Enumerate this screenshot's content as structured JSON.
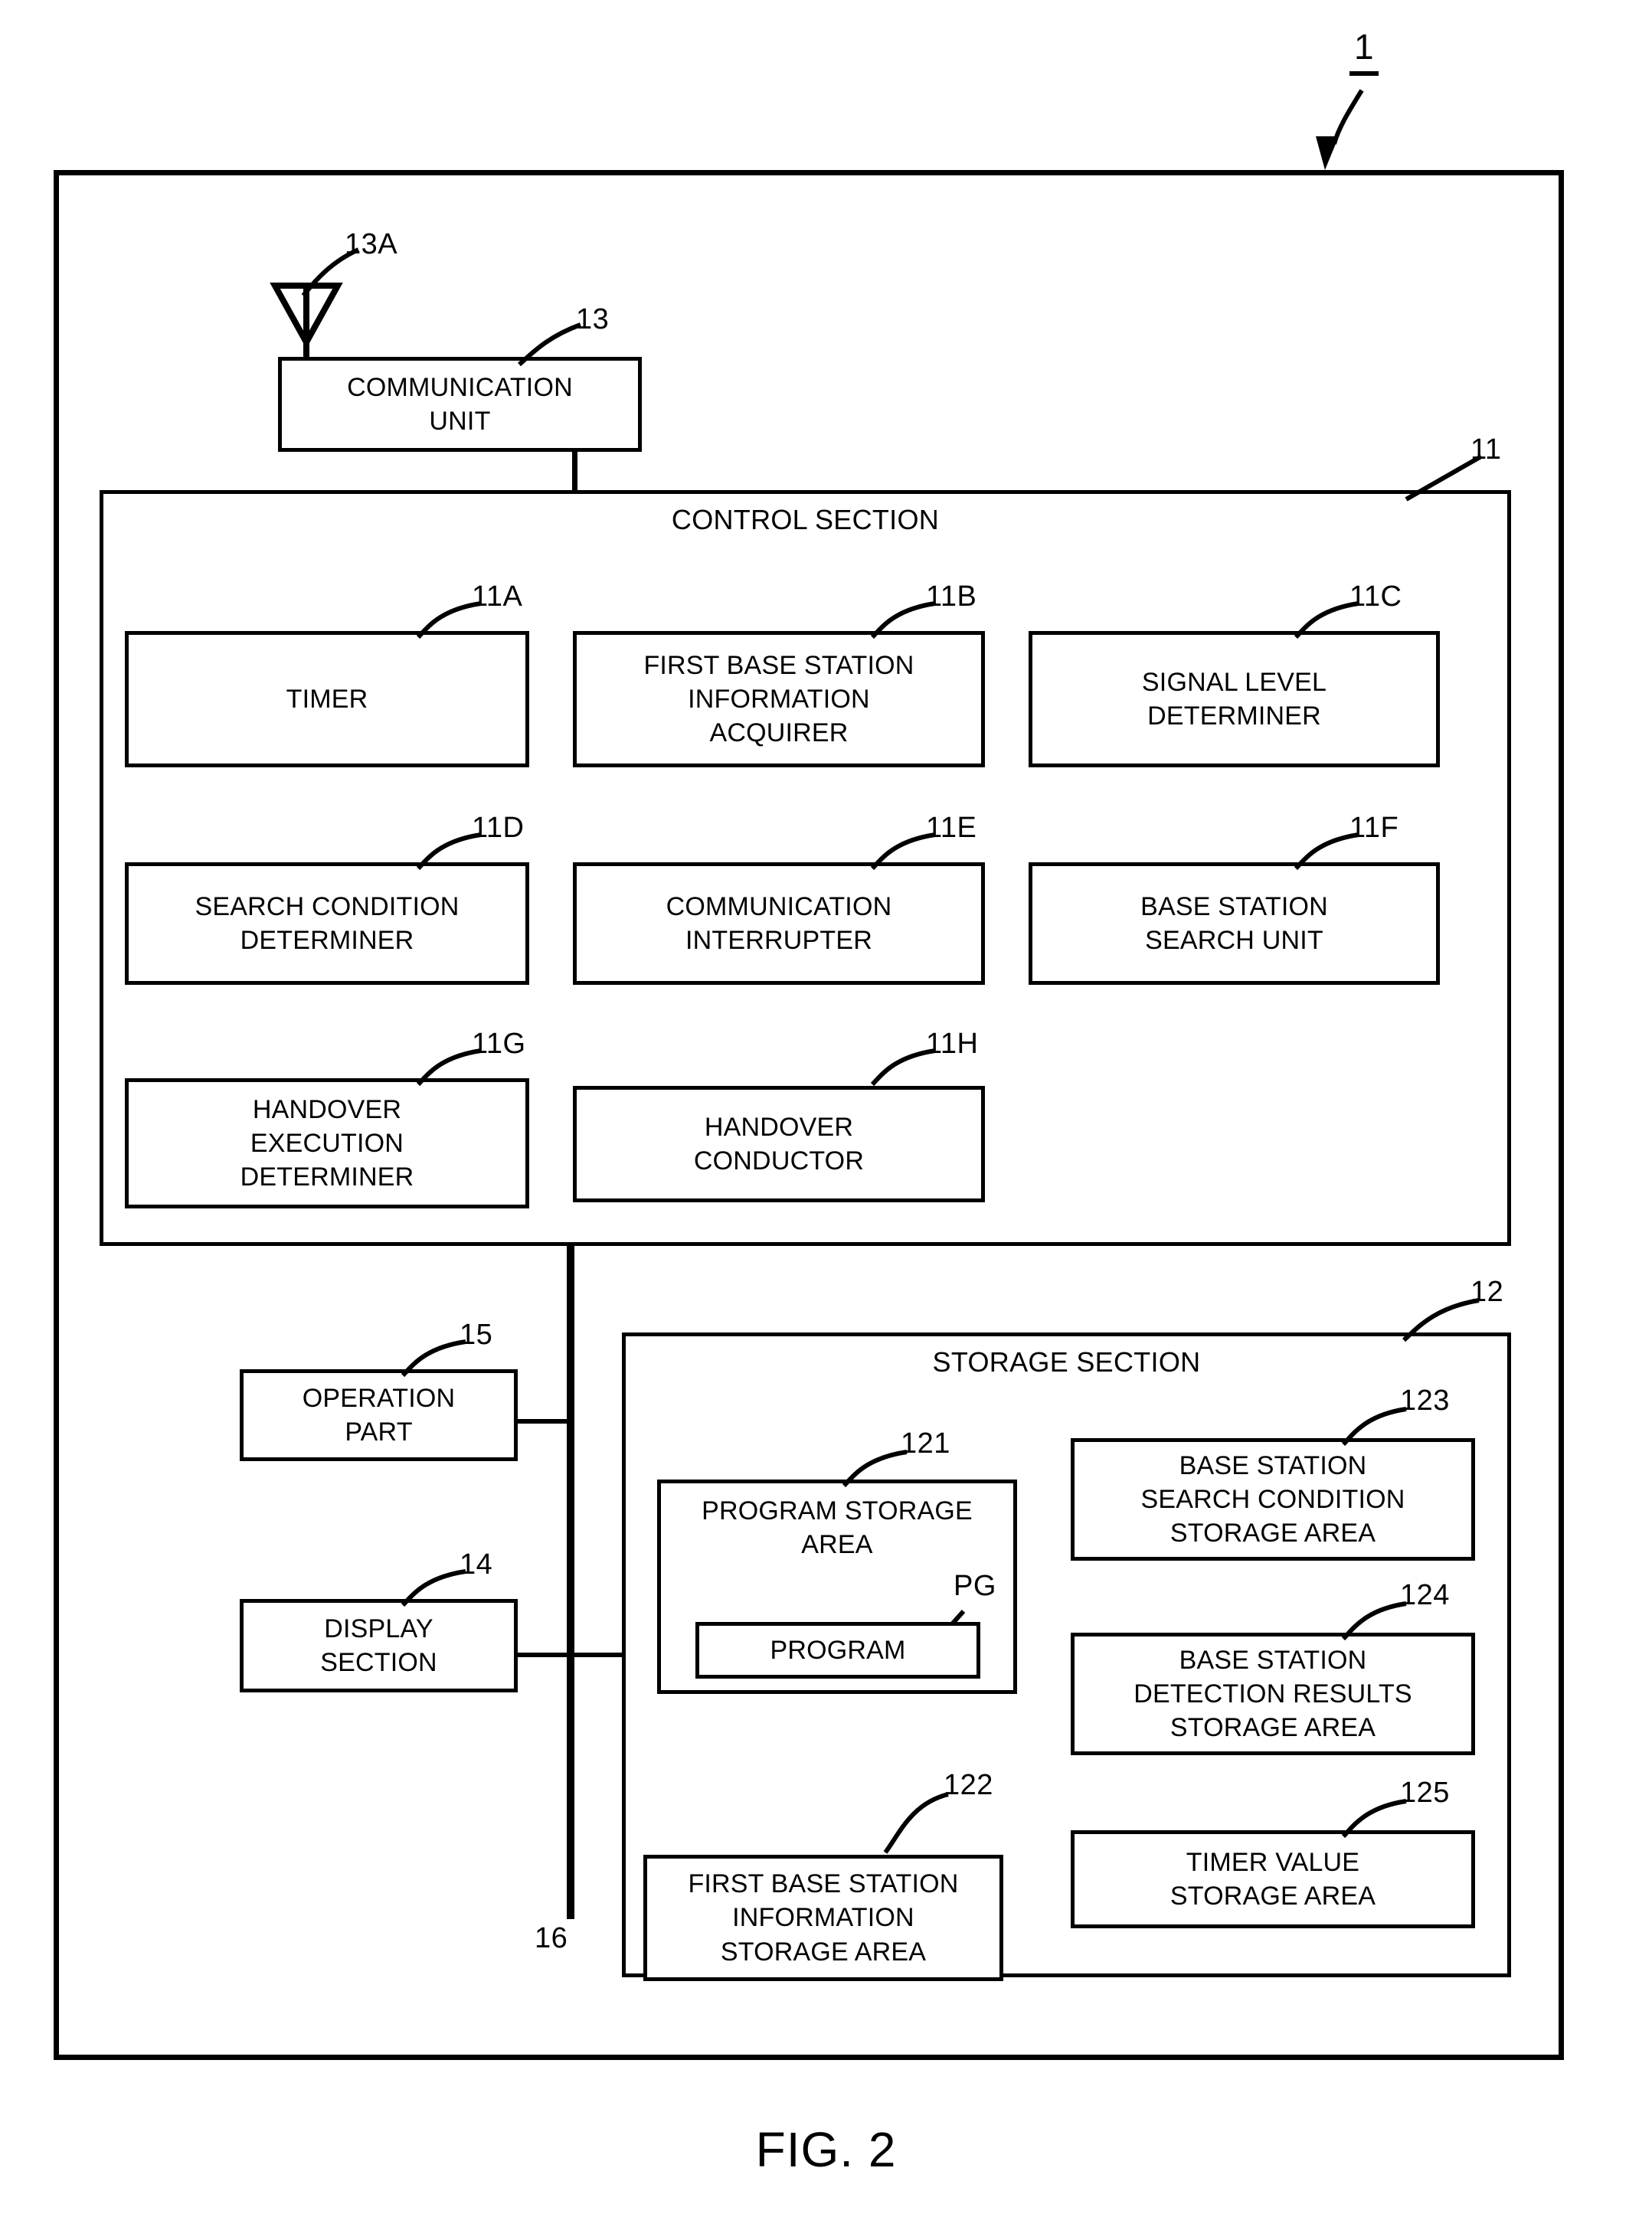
{
  "figure": {
    "caption": "FIG. 2",
    "device_ref": "1"
  },
  "antenna": {
    "ref": "13A",
    "icon": "antenna-icon"
  },
  "communication_unit": {
    "ref": "13",
    "label": "COMMUNICATION\nUNIT"
  },
  "control_section": {
    "ref": "11",
    "title": "CONTROL SECTION",
    "blocks": [
      {
        "ref": "11A",
        "label": "TIMER"
      },
      {
        "ref": "11B",
        "label": "FIRST BASE STATION\nINFORMATION\nACQUIRER"
      },
      {
        "ref": "11C",
        "label": "SIGNAL LEVEL\nDETERMINER"
      },
      {
        "ref": "11D",
        "label": "SEARCH CONDITION\nDETERMINER"
      },
      {
        "ref": "11E",
        "label": "COMMUNICATION\nINTERRUPTER"
      },
      {
        "ref": "11F",
        "label": "BASE STATION\nSEARCH UNIT"
      },
      {
        "ref": "11G",
        "label": "HANDOVER\nEXECUTION\nDETERMINER"
      },
      {
        "ref": "11H",
        "label": "HANDOVER\nCONDUCTOR"
      }
    ]
  },
  "operation_part": {
    "ref": "15",
    "label": "OPERATION\nPART"
  },
  "display_section": {
    "ref": "14",
    "label": "DISPLAY\nSECTION"
  },
  "bus": {
    "ref": "16"
  },
  "storage_section": {
    "ref": "12",
    "title": "STORAGE SECTION",
    "program_storage_area": {
      "ref": "121",
      "label": "PROGRAM STORAGE\nAREA",
      "program": {
        "ref": "PG",
        "label": "PROGRAM"
      }
    },
    "blocks": [
      {
        "ref": "123",
        "label": "BASE STATION\nSEARCH CONDITION\nSTORAGE AREA"
      },
      {
        "ref": "124",
        "label": "BASE STATION\nDETECTION RESULTS\nSTORAGE AREA"
      },
      {
        "ref": "125",
        "label": "TIMER VALUE\nSTORAGE AREA"
      },
      {
        "ref": "122",
        "label": "FIRST BASE STATION\nINFORMATION\nSTORAGE AREA"
      }
    ]
  }
}
